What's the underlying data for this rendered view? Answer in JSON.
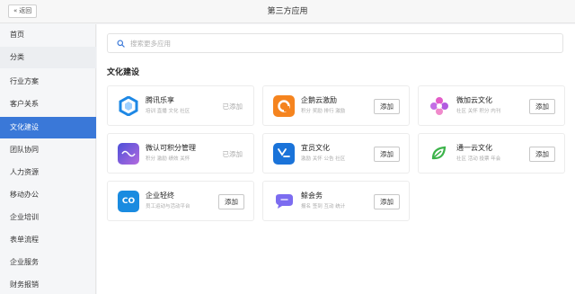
{
  "header": {
    "back_label": "返回",
    "back_icon": "double-chevron-left-icon",
    "title": "第三方应用"
  },
  "sidebar": {
    "items": [
      {
        "label": "首页"
      },
      {
        "label": "分类"
      },
      {
        "label": "行业方案"
      },
      {
        "label": "客户关系"
      },
      {
        "label": "文化建设"
      },
      {
        "label": "团队协同"
      },
      {
        "label": "人力资源"
      },
      {
        "label": "移动办公"
      },
      {
        "label": "企业培训"
      },
      {
        "label": "表单流程"
      },
      {
        "label": "企业服务"
      },
      {
        "label": "财务报销"
      }
    ],
    "active_index": 4,
    "active_color": "#3a78d8"
  },
  "search": {
    "placeholder": "搜索更多应用",
    "icon": "search-icon"
  },
  "section": {
    "title": "文化建设"
  },
  "apps": [
    {
      "name": "腾讯乐享",
      "tags": "培训 直播 文化 社区",
      "status": "已添加",
      "icon": "tencent-lexiang-logo-icon",
      "icon_color": "#1e88e5"
    },
    {
      "name": "企鹅云激励",
      "tags": "积分 奖励 排行 激励",
      "action": "添加",
      "icon": "qie-incentive-logo-icon",
      "icon_color": "#f5841f"
    },
    {
      "name": "微加云文化",
      "tags": "社区 关怀 积分 内刊",
      "action": "添加",
      "icon": "weijia-culture-logo-icon",
      "icon_color": "#d94fd5"
    },
    {
      "name": "微认可积分管理",
      "tags": "积分 激励 绩效 关怀",
      "status": "已添加",
      "icon": "weirenke-logo-icon",
      "icon_color": "#6b5bd6"
    },
    {
      "name": "宜员文化",
      "tags": "激励 关怀 公告 社区",
      "action": "添加",
      "icon": "yiyuan-culture-logo-icon",
      "icon_color": "#1a73d9"
    },
    {
      "name": "通一云文化",
      "tags": "社区 活动 投票 年会",
      "action": "添加",
      "icon": "tongyi-culture-logo-icon",
      "icon_color": "#3cb34a"
    },
    {
      "name": "企业轻终",
      "tags": "员工运动与活动平台",
      "action": "添加",
      "icon": "co-logo-icon",
      "icon_color": "#1a8be0"
    },
    {
      "name": "鲸会务",
      "tags": "报名 签到 互动 统计",
      "action": "添加",
      "icon": "jing-meeting-logo-icon",
      "icon_color": "#7c6cf0"
    }
  ]
}
